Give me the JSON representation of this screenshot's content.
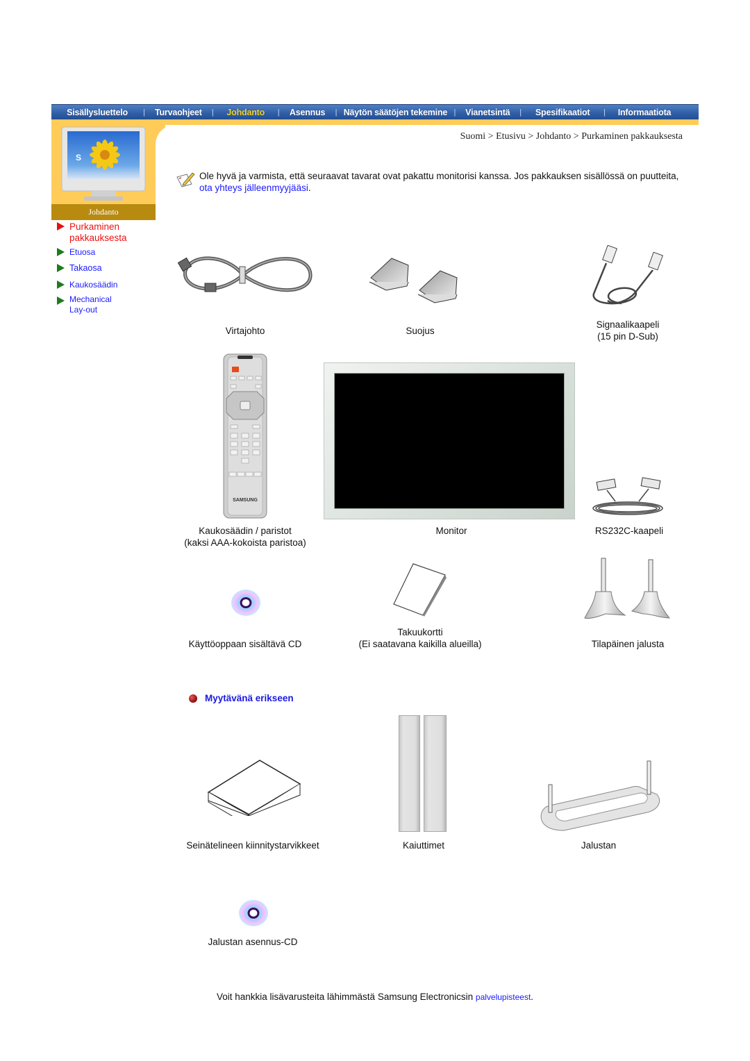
{
  "nav": {
    "items": [
      {
        "label": "Sisällysluettelo",
        "active": false
      },
      {
        "label": "Turvaohjeet",
        "active": false
      },
      {
        "label": "Johdanto",
        "active": true
      },
      {
        "label": "Asennus",
        "active": false
      },
      {
        "label": "Näytön säätöjen tekemine",
        "active": false
      },
      {
        "label": "Vianetsintä",
        "active": false
      },
      {
        "label": "Spesifikaatiot",
        "active": false
      },
      {
        "label": "Informaatiota",
        "active": false
      }
    ],
    "separator": "|"
  },
  "sidebar": {
    "caption": "Johdanto",
    "screen_letter": "S",
    "links": [
      {
        "label": "Purkaminen pakkauksesta",
        "current": true
      },
      {
        "label": "Etuosa",
        "current": false
      },
      {
        "label": "Takaosa",
        "current": false
      },
      {
        "label": "Kaukosäädin",
        "current": false
      },
      {
        "label": "Mechanical Lay-out",
        "current": false
      }
    ]
  },
  "breadcrumb": "Suomi > Etusivu > Johdanto > Purkaminen pakkauksesta",
  "intro": {
    "text_before": "Ole hyvä ja varmista, että seuraavat tavarat ovat pakattu monitorisi kanssa. Jos pakkauksen sisällössä on puutteita, ",
    "link": "ota yhteys jälleenmyyjääsi",
    "text_after": "."
  },
  "included_items": [
    {
      "name": "power-cord",
      "label": "Virtajohto"
    },
    {
      "name": "cover",
      "label": "Suojus"
    },
    {
      "name": "signal-cable",
      "label": "Signaalikaapeli\n(15 pin D-Sub)"
    },
    {
      "name": "remote",
      "label": "Kaukosäädin / paristot\n(kaksi AAA-kokoista paristoa)"
    },
    {
      "name": "monitor",
      "label": "Monitor"
    },
    {
      "name": "rs232c",
      "label": "RS232C-kaapeli"
    },
    {
      "name": "manual-cd",
      "label": "Käyttöoppaan sisältävä CD"
    },
    {
      "name": "warranty",
      "label": "Takuukortti\n(Ei saatavana kaikilla alueilla)"
    },
    {
      "name": "temp-stand",
      "label": "Tilapäinen jalusta"
    }
  ],
  "sold_separately": {
    "heading": "Myytävänä erikseen",
    "items": [
      {
        "name": "wall-mount-kit",
        "label": "Seinätelineen kiinnitystarvikkeet"
      },
      {
        "name": "speakers",
        "label": "Kaiuttimet"
      },
      {
        "name": "stand",
        "label": "Jalustan"
      },
      {
        "name": "stand-cd",
        "label": "Jalustan asennus-CD"
      }
    ]
  },
  "remote_brand": "SAMSUNG",
  "footer": {
    "text": "Voit hankkia lisävarusteita lähimmästä Samsung Electronicsin ",
    "link": "palvelupisteest",
    "end": "."
  },
  "colors": {
    "nav_bg": "#2f5ea6",
    "nav_active": "#f2d12a",
    "orange": "#ffcc5a",
    "caption_bg": "#b88a10",
    "link": "#1a1aff",
    "current": "#ee1111"
  }
}
